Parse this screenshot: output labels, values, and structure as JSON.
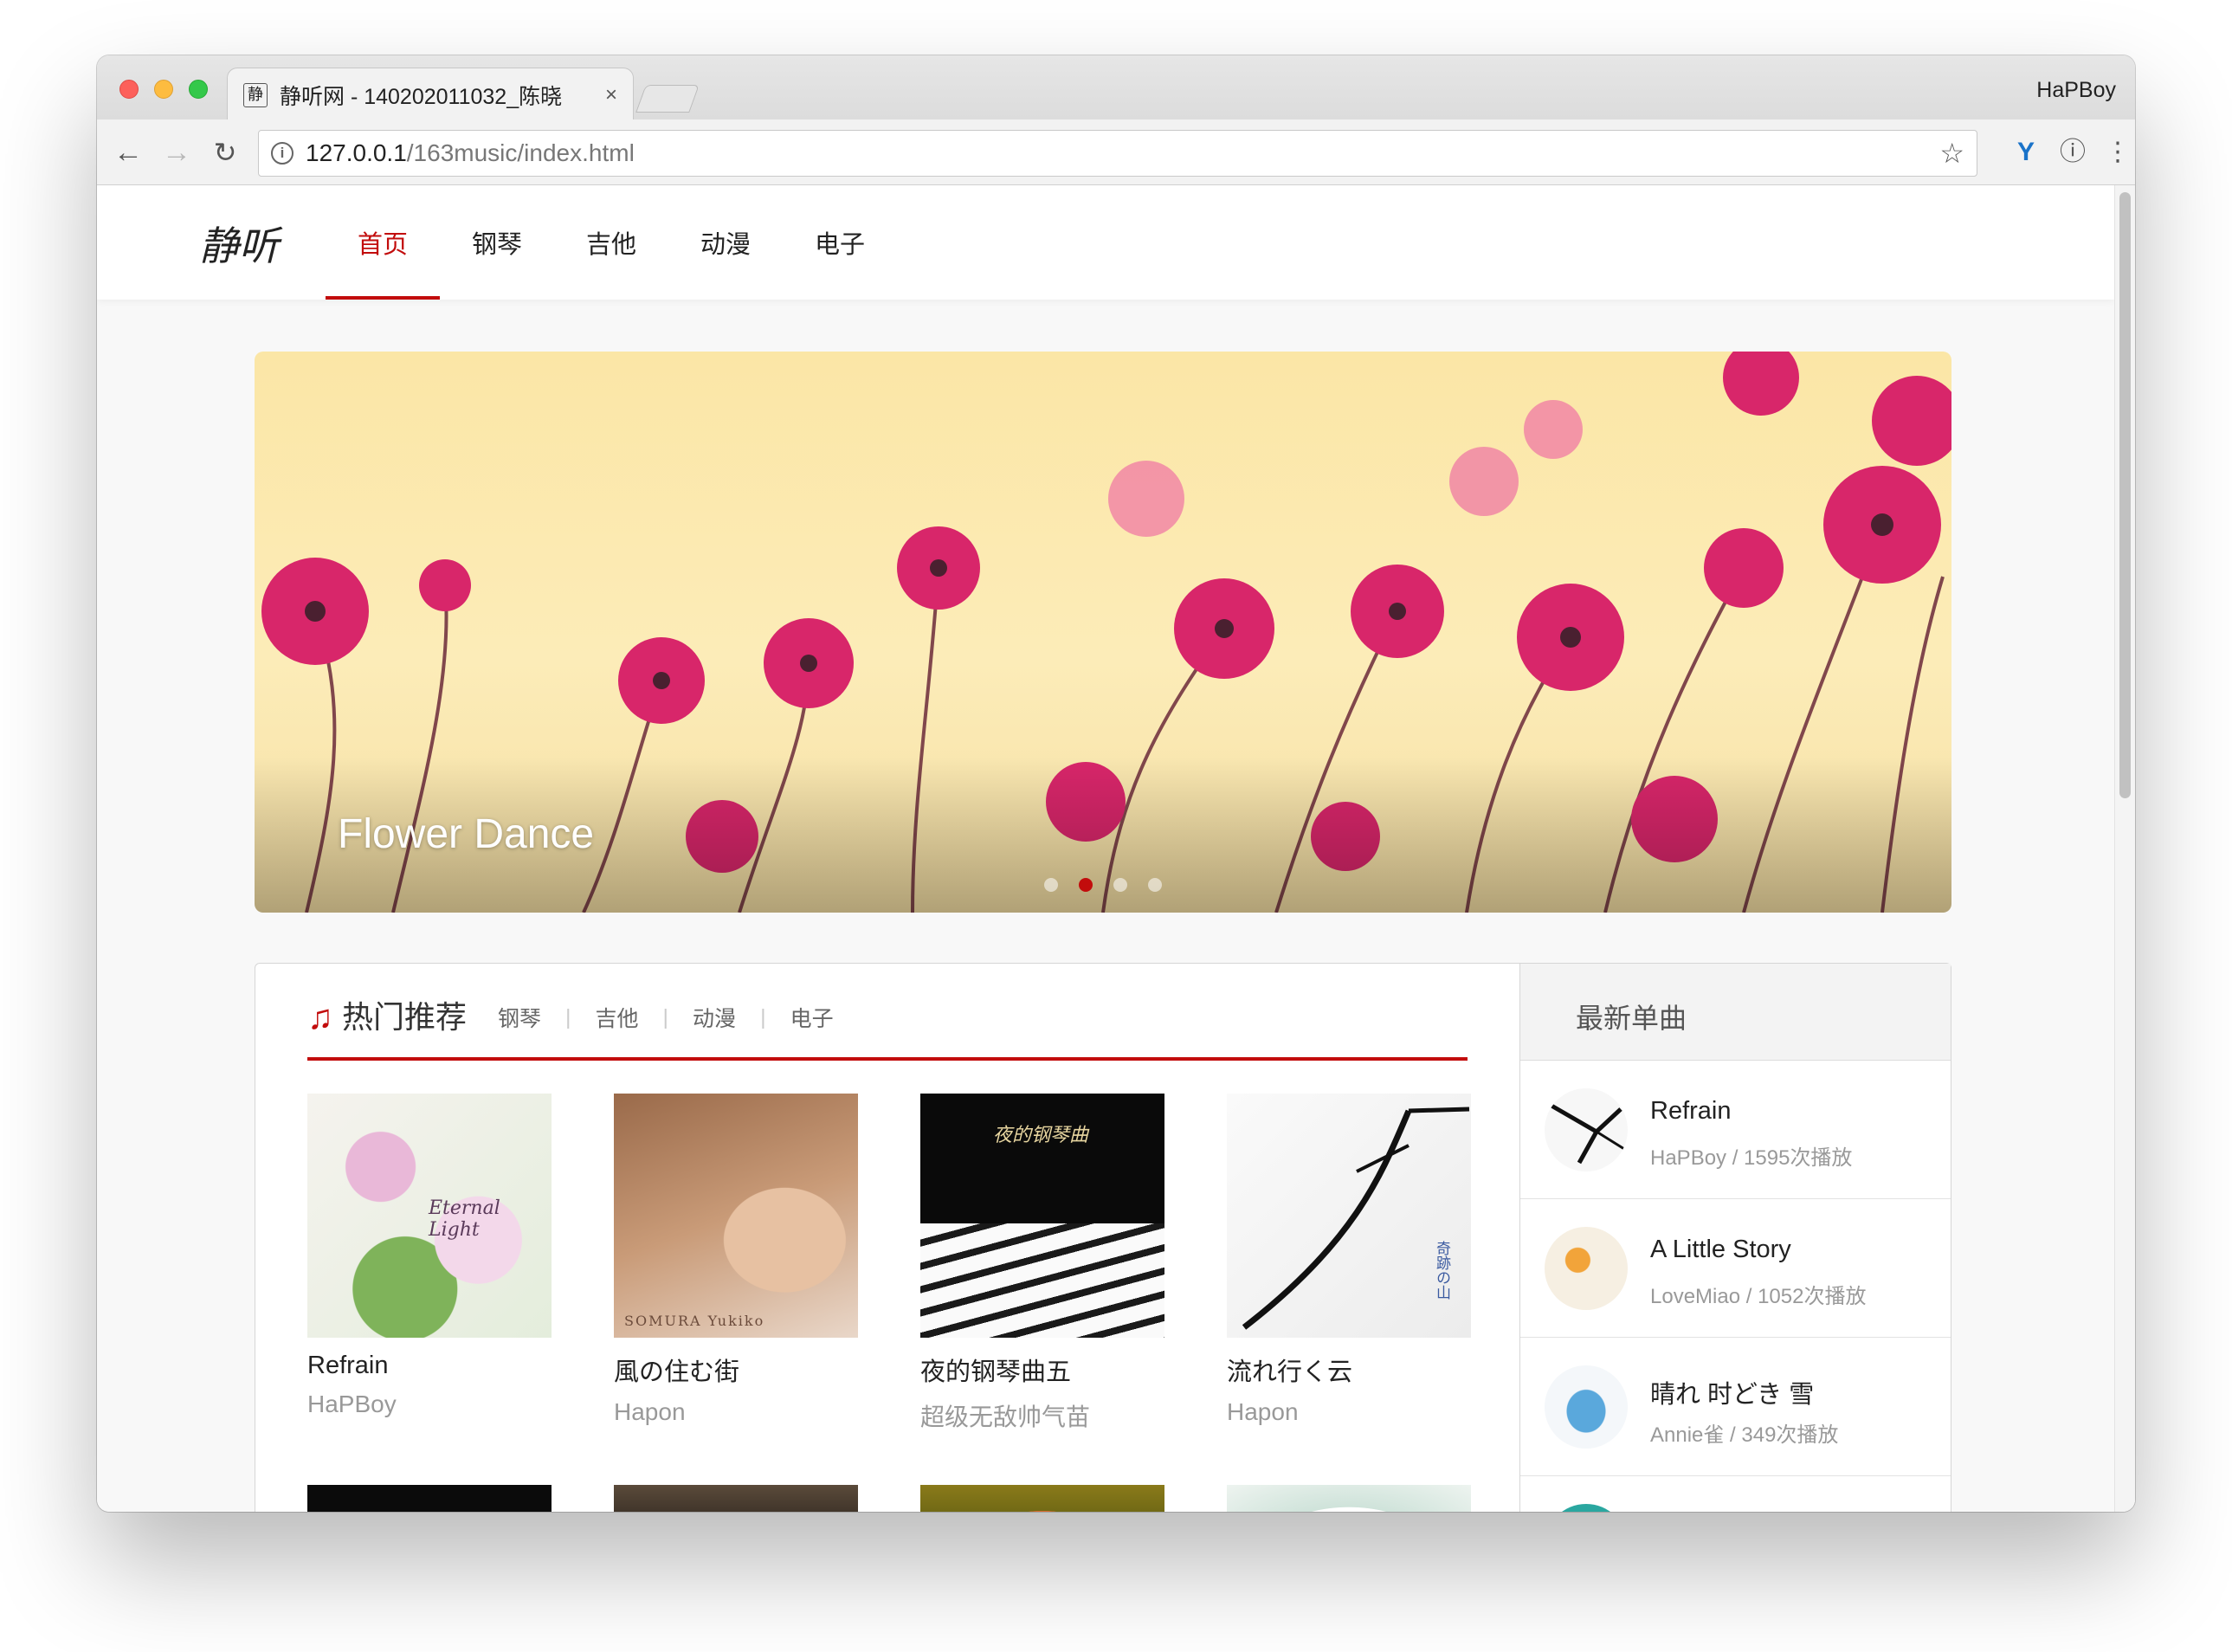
{
  "browser": {
    "tab_title": "静听网 - 140202011032_陈晓",
    "favicon_char": "静",
    "close_glyph": "×",
    "profile_name": "HaPBoy",
    "url_host": "127.0.0.1",
    "url_path": "/163music/index.html"
  },
  "site": {
    "logo": "静听",
    "nav": [
      {
        "label": "首页",
        "active": true
      },
      {
        "label": "钢琴"
      },
      {
        "label": "吉他"
      },
      {
        "label": "动漫"
      },
      {
        "label": "电子"
      }
    ]
  },
  "banner": {
    "title": "Flower Dance",
    "slide_count": 4,
    "active_slide": 2
  },
  "hot": {
    "title": "热门推荐",
    "tabs": [
      "钢琴",
      "吉他",
      "动漫",
      "电子"
    ],
    "tab_separator": "|",
    "albums": [
      {
        "name": "Refrain",
        "artist": "HaPBoy",
        "cover_text": "Eternal Light"
      },
      {
        "name": "風の住む街",
        "artist": "Hapon",
        "cover_text": "SOMURA Yukiko"
      },
      {
        "name": "夜的钢琴曲五",
        "artist": "超级无敌帅气苗",
        "cover_text": "夜的钢琴曲"
      },
      {
        "name": "流れ行く云",
        "artist": "Hapon",
        "cover_text": "奇跡の山"
      }
    ]
  },
  "latest": {
    "title": "最新单曲",
    "songs": [
      {
        "title": "Refrain",
        "meta": "HaPBoy / 1595次播放"
      },
      {
        "title": "A Little Story",
        "meta": "LoveMiao / 1052次播放"
      },
      {
        "title": "晴れ 时どき 雪",
        "meta": "Annie雀 / 349次播放"
      }
    ]
  },
  "colors": {
    "accent": "#c20c0c",
    "banner_bg": "#fbe6a6",
    "flower": "#d81b60"
  },
  "icons": [
    "back-arrow-icon",
    "forward-arrow-icon",
    "reload-icon",
    "info-icon",
    "star-icon",
    "music-note-icon",
    "kebab-menu-icon"
  ]
}
